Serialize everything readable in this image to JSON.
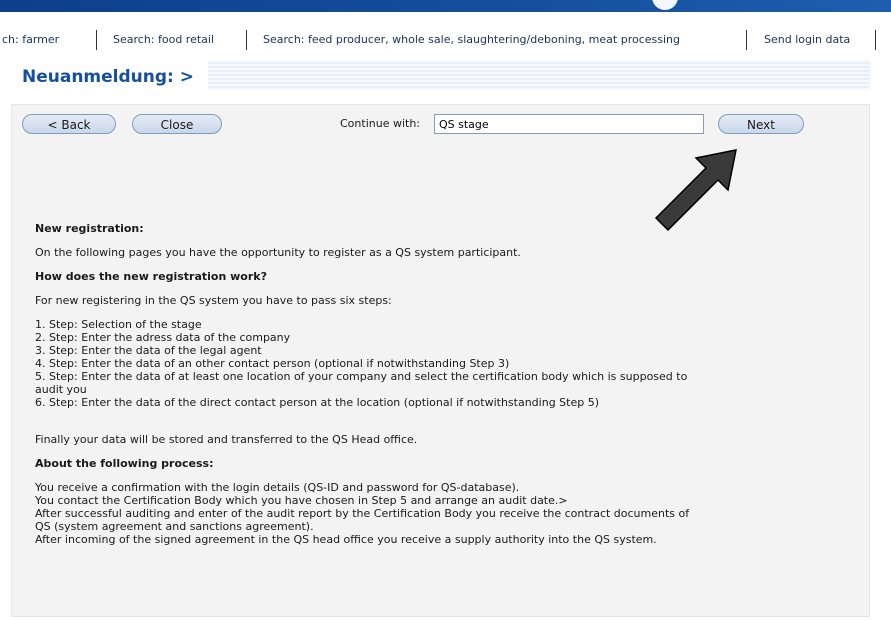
{
  "nav": {
    "items": [
      "ch: farmer",
      "Search: food retail",
      "Search: feed producer, whole sale, slaughtering/deboning, meat processing",
      "Send login data"
    ]
  },
  "page_title": "Neuanmeldung: >",
  "toolbar": {
    "back_label": "< Back",
    "close_label": "Close",
    "continue_label": "Continue with:",
    "continue_value": "QS stage",
    "next_label": "Next"
  },
  "content": {
    "heading1": "New registration:",
    "intro": "On the following pages you have the opportunity to register as a QS system participant.",
    "heading2": "How does the new registration work?",
    "steps_intro": "For new registering in the QS system you have to pass six steps:",
    "steps": [
      "1. Step: Selection of the stage",
      "2. Step: Enter the adress data of the company",
      "3. Step: Enter the data of the legal agent",
      "4. Step: Enter the data of an other contact person (optional if notwithstanding Step 3)",
      "5. Step: Enter the data of at least one location of your company and select the certification body which is supposed to audit you",
      "6. Step: Enter the data of the direct contact person at the location (optional if notwithstanding Step 5)"
    ],
    "final": "Finally your data will be stored and transferred to the QS Head office.",
    "heading3": "About the following process:",
    "process": [
      "You receive a confirmation with the login details (QS-ID and password for QS-database).",
      "You contact the Certification Body which you have chosen in Step 5 and arrange an audit date.>",
      "After successful auditing and enter of the audit report by the Certification Body you receive the contract documents of QS (system agreement and sanctions agreement).",
      "After incoming of the signed agreement in the QS head office you receive a supply authority into the QS system."
    ]
  },
  "icons": {
    "annotation_arrow": "arrow-up-right-icon"
  }
}
